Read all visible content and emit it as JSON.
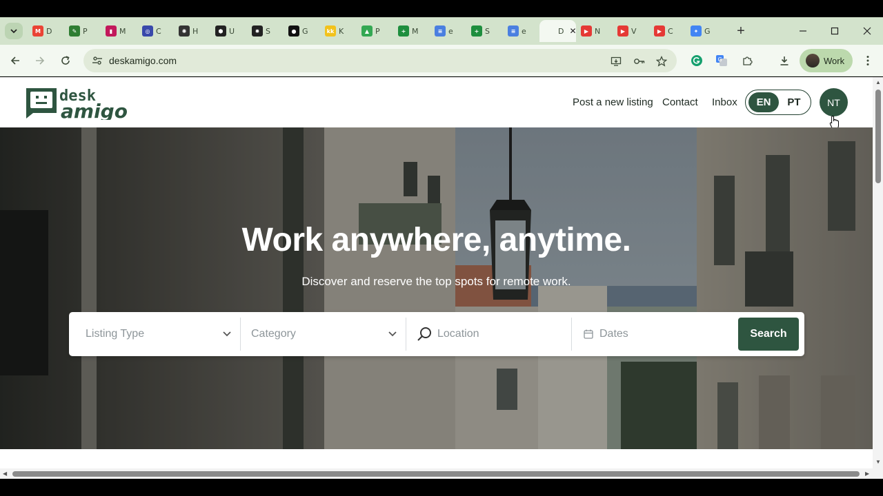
{
  "browser": {
    "tabs": [
      {
        "letter": "D",
        "icon": "gmail-icon",
        "color": "#ea4335",
        "glyph": "M"
      },
      {
        "letter": "P",
        "icon": "tools-icon",
        "color": "#2e7d32",
        "glyph": "✎"
      },
      {
        "letter": "M",
        "icon": "figma-like-icon",
        "color": "#c2185b",
        "glyph": "▮"
      },
      {
        "letter": "C",
        "icon": "circle-app-icon",
        "color": "#3949ab",
        "glyph": "◎"
      },
      {
        "letter": "H",
        "icon": "openai-icon",
        "color": "#333333",
        "glyph": "✺"
      },
      {
        "letter": "U",
        "icon": "hexagon-icon",
        "color": "#222222",
        "glyph": "⬢"
      },
      {
        "letter": "S",
        "icon": "gear-icon",
        "color": "#222222",
        "glyph": "✹"
      },
      {
        "letter": "G",
        "icon": "github-icon",
        "color": "#111111",
        "glyph": "●"
      },
      {
        "letter": "K",
        "icon": "kk-icon",
        "color": "#f2c21b",
        "glyph": "kk"
      },
      {
        "letter": "P",
        "icon": "google-drive-icon",
        "color": "#34a853",
        "glyph": "▲"
      },
      {
        "letter": "M",
        "icon": "google-sheets-plus-icon",
        "color": "#1e8e3e",
        "glyph": "+"
      },
      {
        "letter": "e",
        "icon": "google-docs-icon",
        "color": "#4a7fe0",
        "glyph": "≡"
      },
      {
        "letter": "S",
        "icon": "google-sheets-plus-icon",
        "color": "#1e8e3e",
        "glyph": "+"
      },
      {
        "letter": "e",
        "icon": "google-docs-icon",
        "color": "#4a7fe0",
        "glyph": "≡"
      },
      {
        "letter": "D",
        "icon": "deskamigo-icon",
        "color": "#f3f8f1",
        "glyph": "",
        "active": true
      },
      {
        "letter": "N",
        "icon": "youtube-icon",
        "color": "#e53935",
        "glyph": "▶"
      },
      {
        "letter": "V",
        "icon": "youtube-icon",
        "color": "#e53935",
        "glyph": "▶"
      },
      {
        "letter": "C",
        "icon": "youtube-icon",
        "color": "#e53935",
        "glyph": "▶"
      },
      {
        "letter": "G",
        "icon": "gemini-icon",
        "color": "#4285f4",
        "glyph": "✦"
      }
    ],
    "url": "deskamigo.com",
    "profile_label": "Work"
  },
  "site": {
    "logo_text_top": "desk",
    "logo_text_bottom": "amigo",
    "nav": {
      "post_listing": "Post a new listing",
      "contact": "Contact",
      "inbox": "Inbox"
    },
    "lang": {
      "en": "EN",
      "pt": "PT"
    },
    "user_initials": "NT"
  },
  "hero": {
    "title": "Work anywhere, anytime.",
    "subtitle": "Discover and reserve the top spots for remote work."
  },
  "search": {
    "listing_type_placeholder": "Listing Type",
    "category_placeholder": "Category",
    "location_placeholder": "Location",
    "dates_placeholder": "Dates",
    "button_label": "Search"
  },
  "colors": {
    "brand_green": "#2e5540",
    "tabstrip": "#d3e3cc",
    "toolbar": "#f3f8f1"
  }
}
